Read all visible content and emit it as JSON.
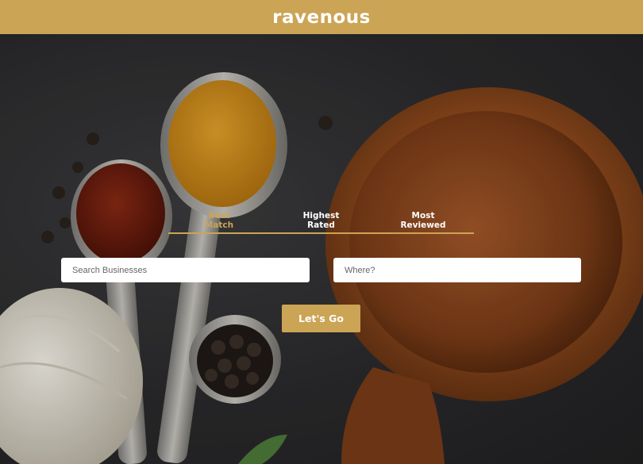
{
  "header": {
    "logo_text": "ravenous"
  },
  "sort_options": [
    {
      "line1": "Best",
      "line2": "Match",
      "active": true
    },
    {
      "line1": "Highest",
      "line2": "Rated",
      "active": false
    },
    {
      "line1": "Most",
      "line2": "Reviewed",
      "active": false
    }
  ],
  "search": {
    "business_placeholder": "Search Businesses",
    "location_placeholder": "Where?",
    "submit_label": "Let's Go"
  },
  "colors": {
    "accent": "#cba455",
    "text_on_accent": "#ffffff"
  },
  "background_image": "spices-and-spoons-photo"
}
